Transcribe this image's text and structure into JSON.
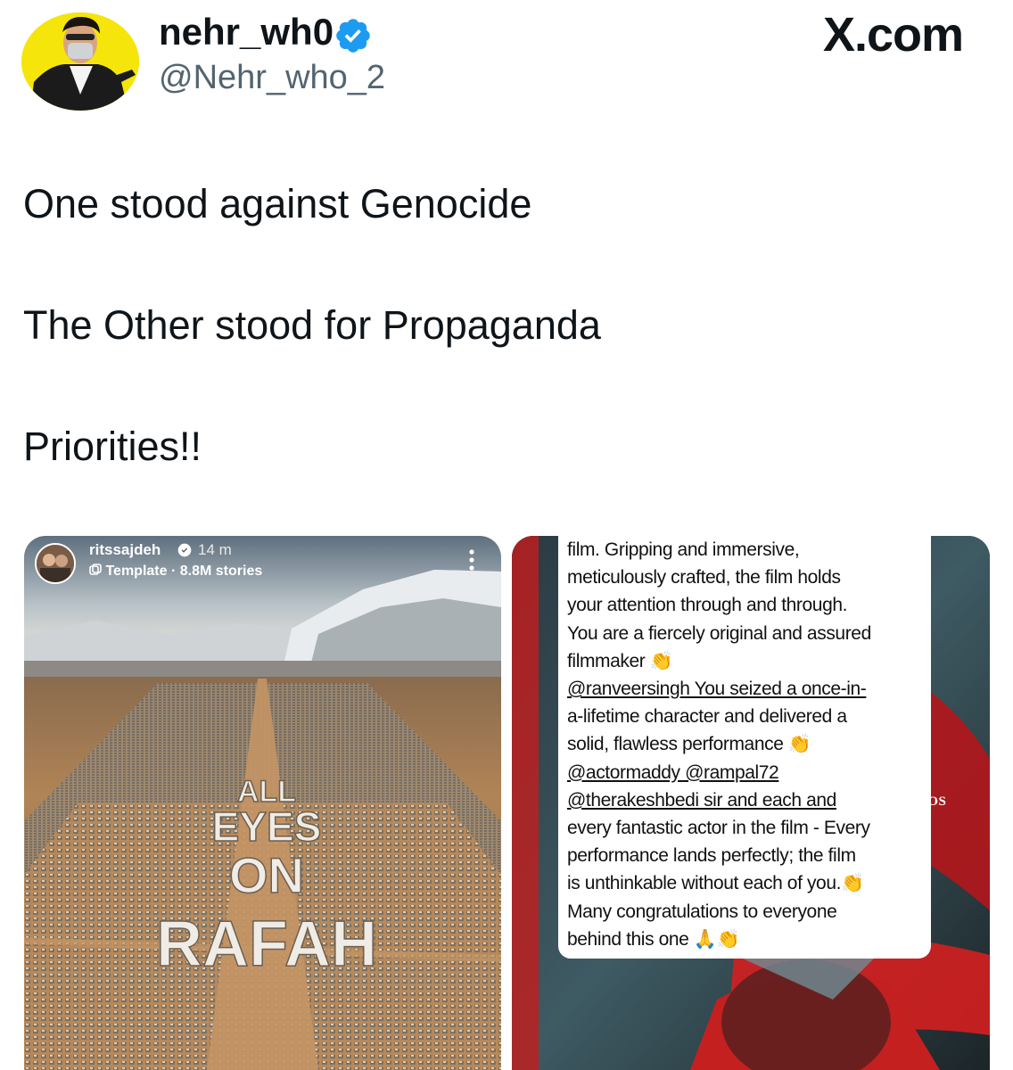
{
  "header": {
    "display_name": "nehr_wh0",
    "handle": "@Nehr_who_2",
    "brand": "X.com",
    "verified_badge": "verified-badge-icon"
  },
  "tweet": {
    "lines": [
      "One stood against Genocide",
      "The Other stood for Propaganda",
      "Priorities!!"
    ]
  },
  "story": {
    "username": "ritssajdeh",
    "time": "14 m",
    "template_label": "Template",
    "stories_count": "8.8M stories",
    "poster_text": [
      "ALL",
      "EYES",
      "ON",
      "RAFAH"
    ]
  },
  "caption": {
    "lines": [
      "film. Gripping and immersive,",
      "meticulously crafted, the film holds",
      "your attention through and through.",
      "You are a fiercely original and assured",
      "filmmaker 👏",
      "@ranveersingh You seized a once-in-",
      "a-lifetime character and delivered a",
      "solid, flawless performance 👏",
      "@actormaddy @rampal72",
      "@therakeshbedi sir and each and",
      "every fantastic actor in the film - Every",
      "performance lands perfectly; the film",
      "is unthinkable without each of you.👏",
      "Many congratulations to everyone",
      "behind this one 🙏👏"
    ],
    "studios_label": "STUDIOS"
  },
  "colors": {
    "verified_blue": "#1d9bf0",
    "avatar_yellow": "#f5e50a",
    "poster_red": "#d41f1f"
  }
}
